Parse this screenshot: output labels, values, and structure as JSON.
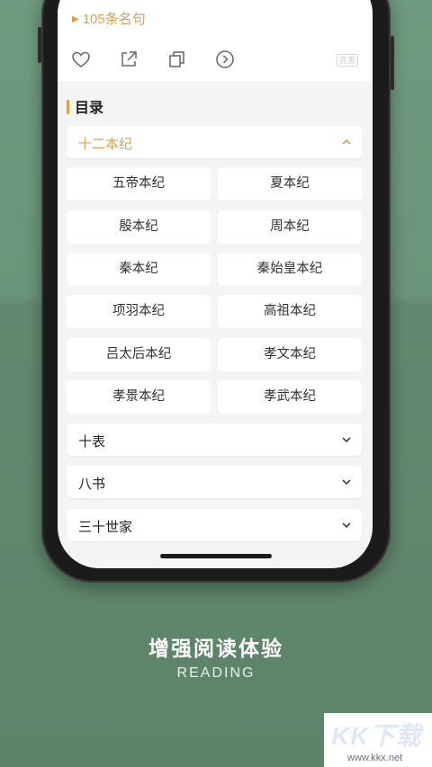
{
  "header": {
    "quote_count": "105条名句"
  },
  "actions": {
    "like_icon": "heart-icon",
    "share_icon": "share-icon",
    "copy_icon": "copy-icon",
    "next_icon": "next-circle-icon",
    "perfect_badge": "完善"
  },
  "toc": {
    "title": "目录",
    "sections": [
      {
        "label": "十二本纪",
        "expanded": true
      },
      {
        "label": "十表",
        "expanded": false
      },
      {
        "label": "八书",
        "expanded": false
      },
      {
        "label": "三十世家",
        "expanded": false
      }
    ],
    "chapters": [
      "五帝本纪",
      "夏本纪",
      "殷本纪",
      "周本纪",
      "秦本纪",
      "秦始皇本纪",
      "项羽本纪",
      "高祖本纪",
      "吕太后本纪",
      "孝文本纪",
      "孝景本纪",
      "孝武本纪"
    ]
  },
  "caption": {
    "main": "增强阅读体验",
    "sub": "READING"
  },
  "watermark": {
    "main": "KK下载",
    "sub": "www.kkx.net"
  },
  "colors": {
    "accent": "#d4a055",
    "background_green": "#5d8469"
  }
}
